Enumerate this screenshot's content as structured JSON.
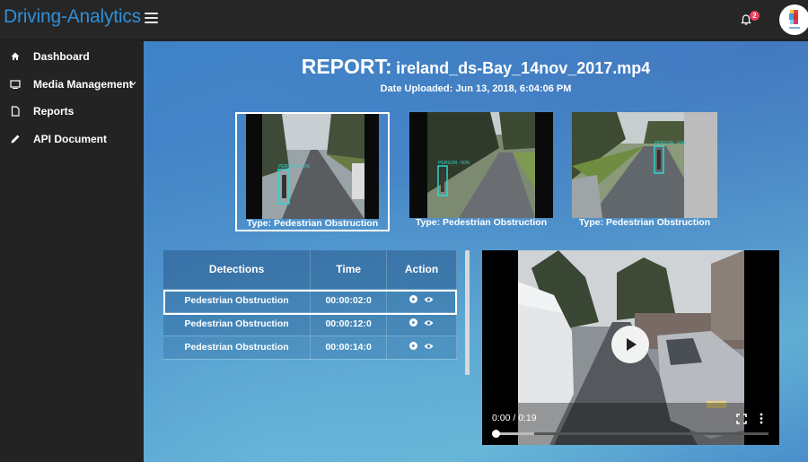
{
  "app": {
    "brand": "Driving-Analytics",
    "notifications_count": "2"
  },
  "sidebar": {
    "items": [
      {
        "label": "Dashboard",
        "icon": "home-icon"
      },
      {
        "label": "Media Management",
        "icon": "monitor-icon",
        "has_submenu": true
      },
      {
        "label": "Reports",
        "icon": "document-icon"
      },
      {
        "label": "API Document",
        "icon": "pencil-icon"
      }
    ]
  },
  "report": {
    "title_label": "REPORT:",
    "filename": "ireland_ds-Bay_14nov_2017.mp4",
    "date_uploaded": "Date Uploaded: Jun 13, 2018, 6:04:06 PM"
  },
  "thumbnails": [
    {
      "caption": "Type: Pedestrian Obstruction",
      "detection_label": "PERSON : 60%",
      "selected": true
    },
    {
      "caption": "Type: Pedestrian Obstruction",
      "detection_label": "PERSON : 50%",
      "selected": false
    },
    {
      "caption": "Type: Pedestrian Obstruction",
      "detection_label": "PERSON : 60%",
      "selected": false
    }
  ],
  "detections_table": {
    "headers": [
      "Detections",
      "Time",
      "Action"
    ],
    "rows": [
      {
        "detection": "Pedestrian Obstruction",
        "time": "00:00:02:0",
        "selected": true
      },
      {
        "detection": "Pedestrian Obstruction",
        "time": "00:00:12:0",
        "selected": false
      },
      {
        "detection": "Pedestrian Obstruction",
        "time": "00:00:14:0",
        "selected": false
      }
    ]
  },
  "player": {
    "time_readout": "0:00 / 0:19",
    "progress_fraction": 0.0,
    "buffered_fraction": 0.14
  },
  "colors": {
    "brand": "#2f8fd8",
    "topbar": "#262626",
    "sidebar": "#232323",
    "badge": "#e83e5a",
    "detection_box": "#2fd6d0"
  }
}
